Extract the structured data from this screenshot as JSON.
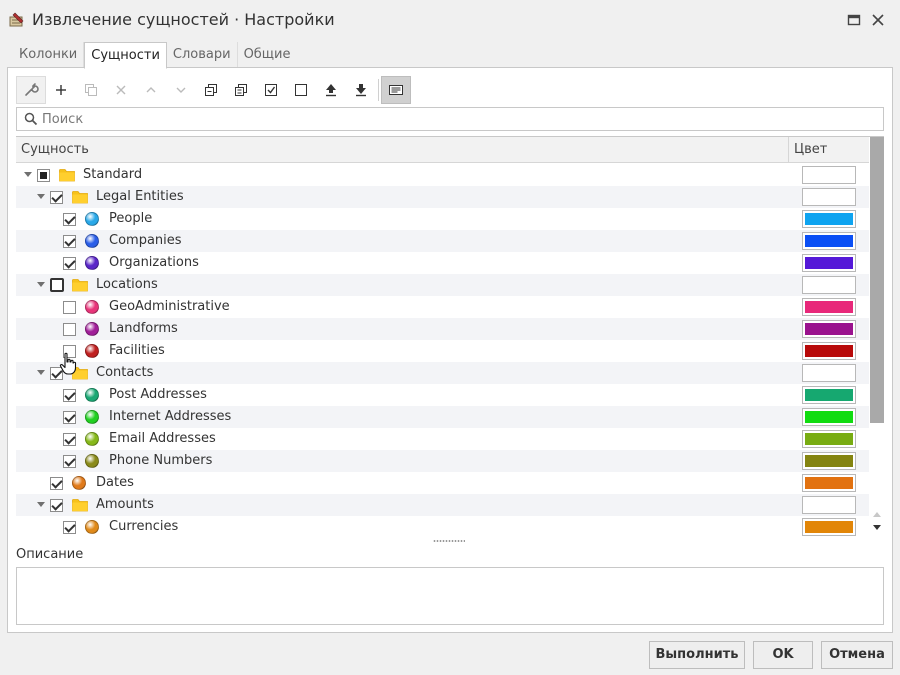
{
  "window": {
    "title": "Извлечение сущностей · Настройки",
    "icon": "entity-extractor-icon",
    "controls": [
      "maximize-icon",
      "close-icon"
    ]
  },
  "tabs": [
    {
      "label": "Колонки",
      "active": false
    },
    {
      "label": "Сущности",
      "active": true
    },
    {
      "label": "Словари",
      "active": false
    },
    {
      "label": "Общие",
      "active": false
    }
  ],
  "toolbar": {
    "buttons": [
      "wrench-icon",
      "plus-icon",
      "copy-icon",
      "delete-icon",
      "move-up-icon",
      "move-down-icon",
      "expand-all-icon",
      "collapse-all-icon",
      "check-all-icon",
      "uncheck-all-icon",
      "import-icon",
      "export-icon",
      "view-mode-icon"
    ]
  },
  "search": {
    "placeholder": "Поиск",
    "value": ""
  },
  "grid": {
    "col_entity": "Сущность",
    "col_color": "Цвет",
    "rows": [
      {
        "label": "Standard",
        "level": 0,
        "type": "folder",
        "check": "indeterminate",
        "expanded": true,
        "color": "#ffffff"
      },
      {
        "label": "Legal Entities",
        "level": 1,
        "type": "folder",
        "check": "checked",
        "expanded": true,
        "color": "#ffffff"
      },
      {
        "label": "People",
        "level": 2,
        "type": "entity",
        "check": "checked",
        "icon_color": "#29a8e8",
        "color": "#0fa4f0"
      },
      {
        "label": "Companies",
        "level": 2,
        "type": "entity",
        "check": "checked",
        "icon_color": "#2a5ee8",
        "color": "#0a4ff5"
      },
      {
        "label": "Organizations",
        "level": 2,
        "type": "entity",
        "check": "checked",
        "icon_color": "#5a26c8",
        "color": "#5418d8"
      },
      {
        "label": "Locations",
        "level": 1,
        "type": "folder",
        "check": "focused",
        "expanded": true,
        "color": "#ffffff"
      },
      {
        "label": "GeoAdministrative",
        "level": 2,
        "type": "entity",
        "check": "unchecked",
        "icon_color": "#e8357a",
        "color": "#e8287a"
      },
      {
        "label": "Landforms",
        "level": 2,
        "type": "entity",
        "check": "unchecked",
        "icon_color": "#a01e98",
        "color": "#9a128e"
      },
      {
        "label": "Facilities",
        "level": 2,
        "type": "entity",
        "check": "unchecked",
        "icon_color": "#c02020",
        "color": "#b80a0a"
      },
      {
        "label": "Contacts",
        "level": 1,
        "type": "folder",
        "check": "checked",
        "expanded": true,
        "color": "#ffffff"
      },
      {
        "label": "Post Addresses",
        "level": 2,
        "type": "entity",
        "check": "checked",
        "icon_color": "#1aa874",
        "color": "#16a870"
      },
      {
        "label": "Internet Addresses",
        "level": 2,
        "type": "entity",
        "check": "checked",
        "icon_color": "#22d022",
        "color": "#10dc10"
      },
      {
        "label": "Email Addresses",
        "level": 2,
        "type": "entity",
        "check": "checked",
        "icon_color": "#86b81a",
        "color": "#78ac12"
      },
      {
        "label": "Phone Numbers",
        "level": 2,
        "type": "entity",
        "check": "checked",
        "icon_color": "#8a8a1a",
        "color": "#848410"
      },
      {
        "label": "Dates",
        "level": 1,
        "type": "entity",
        "check": "checked",
        "icon_color": "#e07a1a",
        "color": "#e27210"
      },
      {
        "label": "Amounts",
        "level": 1,
        "type": "folder",
        "check": "checked",
        "expanded": true,
        "color": "#ffffff"
      },
      {
        "label": "Currencies",
        "level": 2,
        "type": "entity",
        "check": "checked",
        "icon_color": "#e08a1a",
        "color": "#e28608"
      }
    ]
  },
  "description": {
    "label": "Описание",
    "value": ""
  },
  "buttons": {
    "run": "Выполнить",
    "ok": "OK",
    "cancel": "Отмена"
  }
}
